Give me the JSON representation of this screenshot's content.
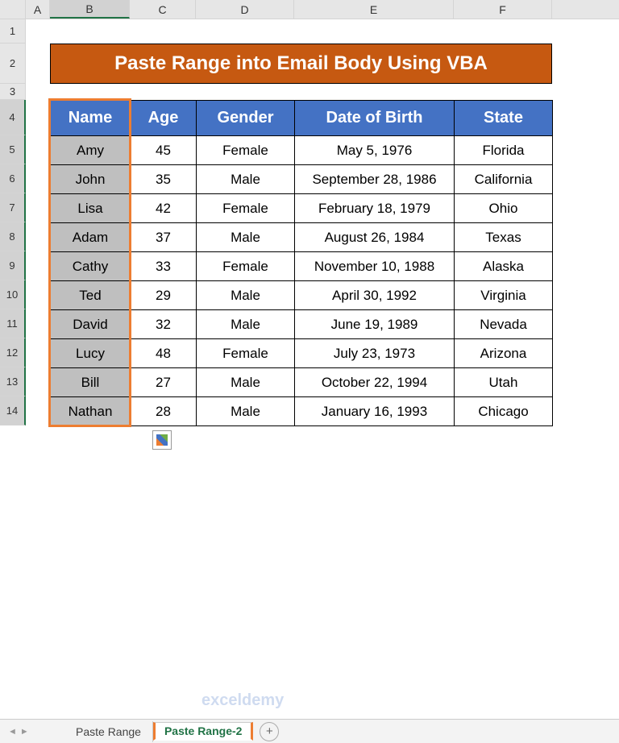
{
  "columns": [
    "A",
    "B",
    "C",
    "D",
    "E",
    "F"
  ],
  "rows": [
    "1",
    "2",
    "3",
    "4",
    "5",
    "6",
    "7",
    "8",
    "9",
    "10",
    "11",
    "12",
    "13",
    "14"
  ],
  "title": "Paste Range into Email Body Using VBA",
  "headers": [
    "Name",
    "Age",
    "Gender",
    "Date of Birth",
    "State"
  ],
  "data": [
    [
      "Amy",
      "45",
      "Female",
      "May 5, 1976",
      "Florida"
    ],
    [
      "John",
      "35",
      "Male",
      "September 28, 1986",
      "California"
    ],
    [
      "Lisa",
      "42",
      "Female",
      "February 18, 1979",
      "Ohio"
    ],
    [
      "Adam",
      "37",
      "Male",
      "August 26, 1984",
      "Texas"
    ],
    [
      "Cathy",
      "33",
      "Female",
      "November 10, 1988",
      "Alaska"
    ],
    [
      "Ted",
      "29",
      "Male",
      "April 30, 1992",
      "Virginia"
    ],
    [
      "David",
      "32",
      "Male",
      "June 19, 1989",
      "Nevada"
    ],
    [
      "Lucy",
      "48",
      "Female",
      "July 23, 1973",
      "Arizona"
    ],
    [
      "Bill",
      "27",
      "Male",
      "October 22, 1994",
      "Utah"
    ],
    [
      "Nathan",
      "28",
      "Male",
      "January 16, 1993",
      "Chicago"
    ]
  ],
  "tabs": {
    "t1": "Paste Range",
    "t2": "Paste Range-2"
  },
  "watermark": "exceldemy",
  "addTab": "+"
}
